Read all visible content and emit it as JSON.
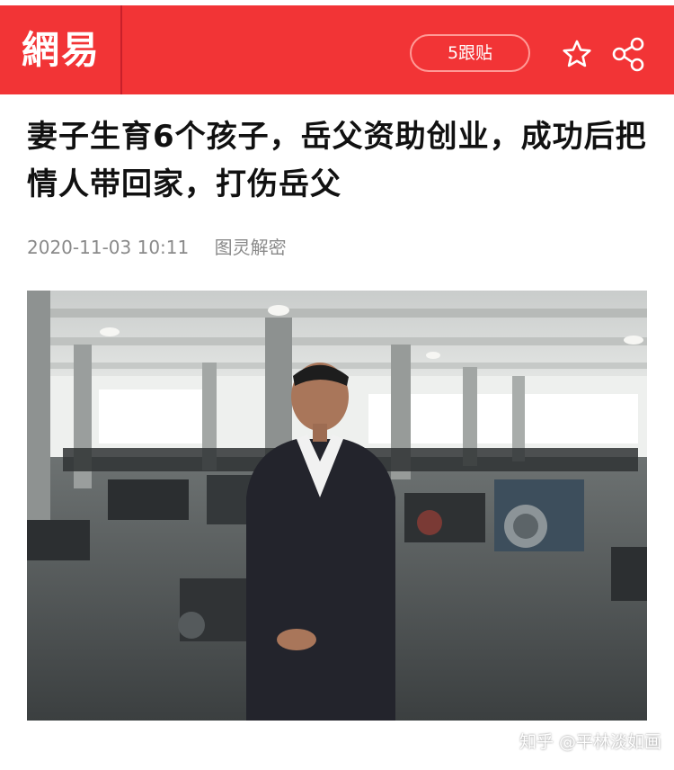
{
  "header": {
    "logo_text": "網易",
    "comments_button": "5跟贴",
    "brand_color": "#f23436",
    "icons": [
      "star-icon",
      "share-icon"
    ]
  },
  "article": {
    "title": "妻子生育6个孩子，岳父资助创业，成功后把情人带回家，打伤岳父",
    "date": "2020-11-03 10:11",
    "source": "图灵解密"
  },
  "photo": {
    "description_icon": "article-photo"
  },
  "watermark": {
    "text": "知乎 @平林淡如画"
  }
}
